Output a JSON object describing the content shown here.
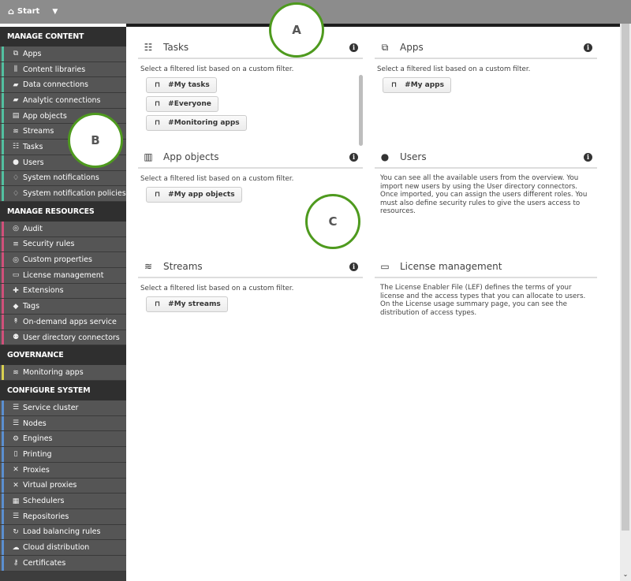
{
  "topbar": {
    "start_label": "Start",
    "home_icon": "home-icon",
    "dropdown_icon": "caret-down-icon"
  },
  "sidebar": {
    "sections": [
      {
        "title": "MANAGE CONTENT",
        "accent": "#52c0a0",
        "items": [
          {
            "label": "Apps",
            "icon": "⧉"
          },
          {
            "label": "Content libraries",
            "icon": "⫼"
          },
          {
            "label": "Data connections",
            "icon": "▰"
          },
          {
            "label": "Analytic connections",
            "icon": "▰"
          },
          {
            "label": "App objects",
            "icon": "▤"
          },
          {
            "label": "Streams",
            "icon": "≋"
          },
          {
            "label": "Tasks",
            "icon": "☷"
          },
          {
            "label": "Users",
            "icon": "●"
          },
          {
            "label": "System notifications",
            "icon": "♢"
          },
          {
            "label": "System notification policies",
            "icon": "♢"
          }
        ]
      },
      {
        "title": "MANAGE RESOURCES",
        "accent": "#d0507a",
        "items": [
          {
            "label": "Audit",
            "icon": "◎"
          },
          {
            "label": "Security rules",
            "icon": "≡"
          },
          {
            "label": "Custom properties",
            "icon": "◎"
          },
          {
            "label": "License management",
            "icon": "▭"
          },
          {
            "label": "Extensions",
            "icon": "✚"
          },
          {
            "label": "Tags",
            "icon": "◆"
          },
          {
            "label": "On-demand apps service",
            "icon": "↟"
          },
          {
            "label": "User directory connectors",
            "icon": "⚉"
          }
        ]
      },
      {
        "title": "GOVERNANCE",
        "accent": "#d8d050",
        "items": [
          {
            "label": "Monitoring apps",
            "icon": "≋"
          }
        ]
      },
      {
        "title": "CONFIGURE SYSTEM",
        "accent": "#5b8fd0",
        "items": [
          {
            "label": "Service cluster",
            "icon": "☰"
          },
          {
            "label": "Nodes",
            "icon": "☰"
          },
          {
            "label": "Engines",
            "icon": "⚙"
          },
          {
            "label": "Printing",
            "icon": "▯"
          },
          {
            "label": "Proxies",
            "icon": "✕"
          },
          {
            "label": "Virtual proxies",
            "icon": "✕"
          },
          {
            "label": "Schedulers",
            "icon": "▦"
          },
          {
            "label": "Repositories",
            "icon": "☰"
          },
          {
            "label": "Load balancing rules",
            "icon": "↻"
          },
          {
            "label": "Cloud distribution",
            "icon": "☁"
          },
          {
            "label": "Certificates",
            "icon": "⚷"
          }
        ]
      }
    ]
  },
  "cards": {
    "tasks": {
      "title": "Tasks",
      "desc": "Select a filtered list based on a custom filter.",
      "chips": [
        "#My tasks",
        "#Everyone",
        "#Monitoring apps"
      ]
    },
    "apps": {
      "title": "Apps",
      "desc": "Select a filtered list based on a custom filter.",
      "chips": [
        "#My apps"
      ]
    },
    "app_objects": {
      "title": "App objects",
      "desc": "Select a filtered list based on a custom filter.",
      "chips": [
        "#My app objects"
      ]
    },
    "users": {
      "title": "Users",
      "text": "You can see all the available users from the overview. You import new users by using the User directory connectors. Once imported, you can assign the users different roles. You must also define security rules to give the users access to resources."
    },
    "streams": {
      "title": "Streams",
      "desc": "Select a filtered list based on a custom filter.",
      "chips": [
        "#My streams"
      ]
    },
    "license": {
      "title": "License management",
      "text": "The License Enabler File (LEF) defines the terms of your license and the access types that you can allocate to users. On the License usage summary page, you can see the distribution of access types."
    }
  },
  "callouts": {
    "a": "A",
    "b": "B",
    "c": "C"
  },
  "info_glyph": "i",
  "bookmark_glyph": "⊓"
}
